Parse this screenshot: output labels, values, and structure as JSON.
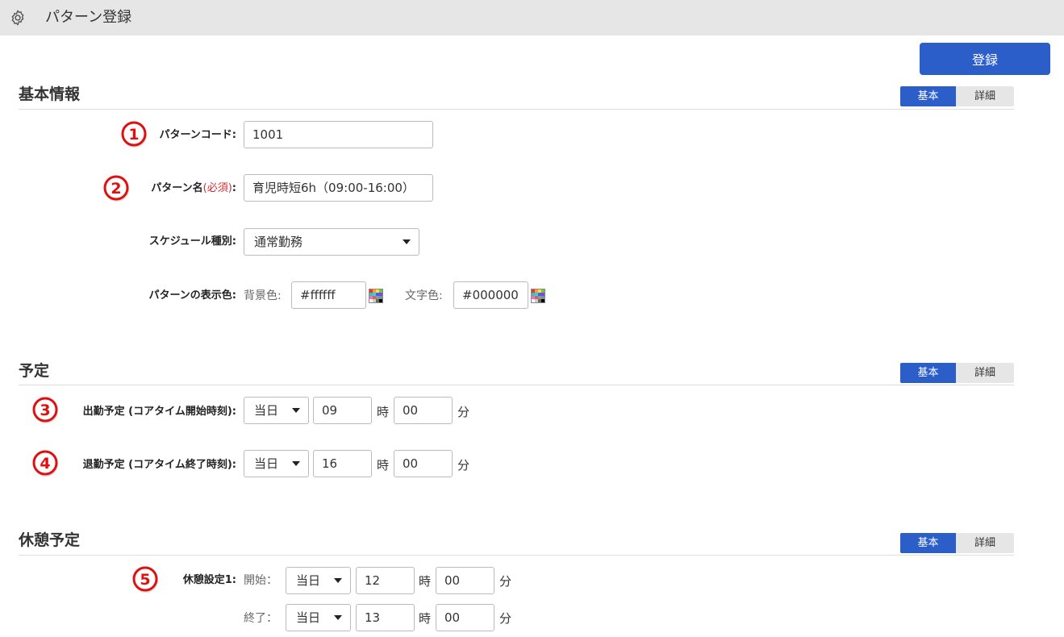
{
  "header": {
    "title": "パターン登録"
  },
  "actions": {
    "register_label": "登録"
  },
  "toggle": {
    "basic": "基本",
    "detail": "詳細"
  },
  "sections": {
    "basic_info": "基本情報",
    "schedule": "予定",
    "break": "休憩予定"
  },
  "badges": [
    "①",
    "②",
    "③",
    "④",
    "⑤"
  ],
  "fields": {
    "pattern_code": {
      "label": "パターンコード:",
      "value": "1001"
    },
    "pattern_name": {
      "label": "パターン名",
      "required": "(必須)",
      "colon": ":",
      "value": "育児時短6h（09:00-16:00）"
    },
    "schedule_type": {
      "label": "スケジュール種別:",
      "value": "通常勤務"
    },
    "display_color": {
      "label": "パターンの表示色:",
      "bg_label": "背景色:",
      "bg_value": "#ffffff",
      "text_label": "文字色:",
      "text_value": "#000000"
    },
    "clock_in": {
      "label": "出勤予定 (コアタイム開始時刻):",
      "day": "当日",
      "hour": "09",
      "minute": "00"
    },
    "clock_out": {
      "label": "退勤予定 (コアタイム終了時刻):",
      "day": "当日",
      "hour": "16",
      "minute": "00"
    },
    "break1": {
      "label": "休憩設定1:",
      "start_label": "開始：",
      "start_day": "当日",
      "start_hour": "12",
      "start_minute": "00",
      "end_label": "終了：",
      "end_day": "当日",
      "end_hour": "13",
      "end_minute": "00"
    }
  },
  "units": {
    "hour": "時",
    "minute": "分"
  },
  "colors": {
    "accent": "#2c5ec9",
    "badge_red": "#e01010",
    "required": "#d03030"
  }
}
